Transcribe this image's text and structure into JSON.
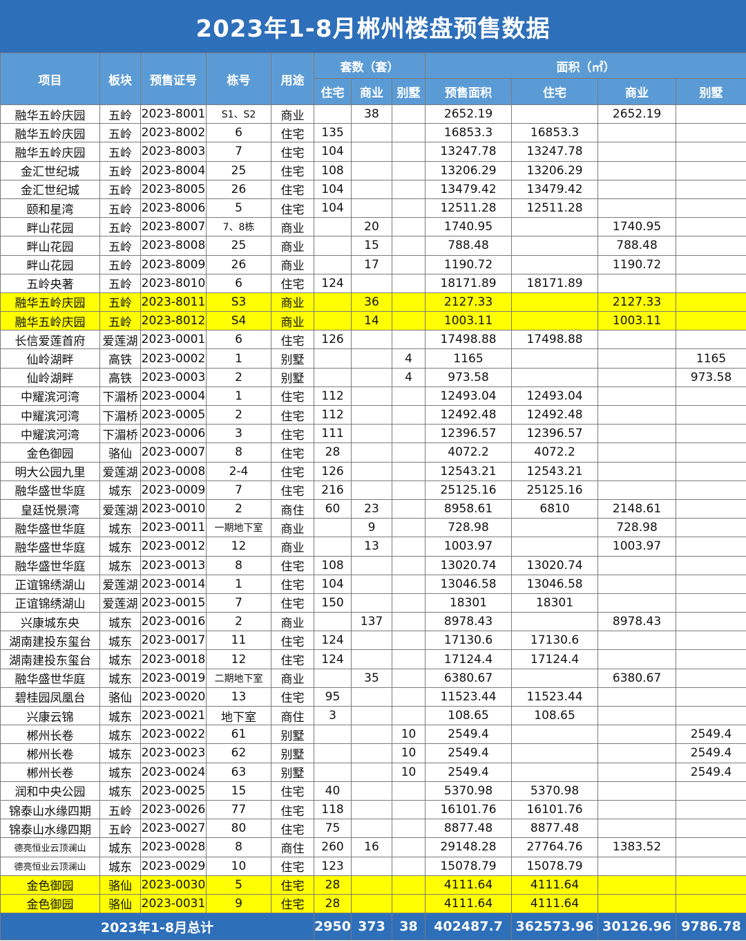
{
  "title": "2023年1-8月郴州楼盘预售数据",
  "headers": {
    "project": "项目",
    "block": "板块",
    "cert": "预售证号",
    "building": "栋号",
    "use": "用途",
    "units_group": "套数（套）",
    "area_group": "面积（㎡）",
    "units_residential": "住宅",
    "units_commercial": "商业",
    "units_villa": "别墅",
    "area_presale": "预售面积",
    "area_residential": "住宅",
    "area_commercial": "商业",
    "area_villa": "别墅"
  },
  "rows": [
    {
      "project": "融华五岭庆园",
      "block": "五岭",
      "cert": "2023-8001",
      "building": "S1、S2",
      "use": "商业",
      "ur": "",
      "uc": "38",
      "uv": "",
      "area": "2652.19",
      "ar": "",
      "ac": "2652.19",
      "av": "",
      "hl": false
    },
    {
      "project": "融华五岭庆园",
      "block": "五岭",
      "cert": "2023-8002",
      "building": "6",
      "use": "住宅",
      "ur": "135",
      "uc": "",
      "uv": "",
      "area": "16853.3",
      "ar": "16853.3",
      "ac": "",
      "av": "",
      "hl": false
    },
    {
      "project": "融华五岭庆园",
      "block": "五岭",
      "cert": "2023-8003",
      "building": "7",
      "use": "住宅",
      "ur": "104",
      "uc": "",
      "uv": "",
      "area": "13247.78",
      "ar": "13247.78",
      "ac": "",
      "av": "",
      "hl": false
    },
    {
      "project": "金汇世纪城",
      "block": "五岭",
      "cert": "2023-8004",
      "building": "25",
      "use": "住宅",
      "ur": "108",
      "uc": "",
      "uv": "",
      "area": "13206.29",
      "ar": "13206.29",
      "ac": "",
      "av": "",
      "hl": false
    },
    {
      "project": "金汇世纪城",
      "block": "五岭",
      "cert": "2023-8005",
      "building": "26",
      "use": "住宅",
      "ur": "104",
      "uc": "",
      "uv": "",
      "area": "13479.42",
      "ar": "13479.42",
      "ac": "",
      "av": "",
      "hl": false
    },
    {
      "project": "颐和星湾",
      "block": "五岭",
      "cert": "2023-8006",
      "building": "5",
      "use": "住宅",
      "ur": "104",
      "uc": "",
      "uv": "",
      "area": "12511.28",
      "ar": "12511.28",
      "ac": "",
      "av": "",
      "hl": false
    },
    {
      "project": "畔山花园",
      "block": "五岭",
      "cert": "2023-8007",
      "building": "7、8栋",
      "use": "商业",
      "ur": "",
      "uc": "20",
      "uv": "",
      "area": "1740.95",
      "ar": "",
      "ac": "1740.95",
      "av": "",
      "hl": false
    },
    {
      "project": "畔山花园",
      "block": "五岭",
      "cert": "2023-8008",
      "building": "25",
      "use": "商业",
      "ur": "",
      "uc": "15",
      "uv": "",
      "area": "788.48",
      "ar": "",
      "ac": "788.48",
      "av": "",
      "hl": false
    },
    {
      "project": "畔山花园",
      "block": "五岭",
      "cert": "2023-8009",
      "building": "26",
      "use": "商业",
      "ur": "",
      "uc": "17",
      "uv": "",
      "area": "1190.72",
      "ar": "",
      "ac": "1190.72",
      "av": "",
      "hl": false
    },
    {
      "project": "五岭央著",
      "block": "五岭",
      "cert": "2023-8010",
      "building": "6",
      "use": "住宅",
      "ur": "124",
      "uc": "",
      "uv": "",
      "area": "18171.89",
      "ar": "18171.89",
      "ac": "",
      "av": "",
      "hl": false
    },
    {
      "project": "融华五岭庆园",
      "block": "五岭",
      "cert": "2023-8011",
      "building": "S3",
      "use": "商业",
      "ur": "",
      "uc": "36",
      "uv": "",
      "area": "2127.33",
      "ar": "",
      "ac": "2127.33",
      "av": "",
      "hl": true
    },
    {
      "project": "融华五岭庆园",
      "block": "五岭",
      "cert": "2023-8012",
      "building": "S4",
      "use": "商业",
      "ur": "",
      "uc": "14",
      "uv": "",
      "area": "1003.11",
      "ar": "",
      "ac": "1003.11",
      "av": "",
      "hl": true
    },
    {
      "project": "长信爱莲首府",
      "block": "爱莲湖",
      "cert": "2023-0001",
      "building": "6",
      "use": "住宅",
      "ur": "126",
      "uc": "",
      "uv": "",
      "area": "17498.88",
      "ar": "17498.88",
      "ac": "",
      "av": "",
      "hl": false
    },
    {
      "project": "仙岭湖畔",
      "block": "高铁",
      "cert": "2023-0002",
      "building": "1",
      "use": "别墅",
      "ur": "",
      "uc": "",
      "uv": "4",
      "area": "1165",
      "ar": "",
      "ac": "",
      "av": "1165",
      "hl": false
    },
    {
      "project": "仙岭湖畔",
      "block": "高铁",
      "cert": "2023-0003",
      "building": "2",
      "use": "别墅",
      "ur": "",
      "uc": "",
      "uv": "4",
      "area": "973.58",
      "ar": "",
      "ac": "",
      "av": "973.58",
      "hl": false
    },
    {
      "project": "中耀滨河湾",
      "block": "下湄桥",
      "cert": "2023-0004",
      "building": "1",
      "use": "住宅",
      "ur": "112",
      "uc": "",
      "uv": "",
      "area": "12493.04",
      "ar": "12493.04",
      "ac": "",
      "av": "",
      "hl": false
    },
    {
      "project": "中耀滨河湾",
      "block": "下湄桥",
      "cert": "2023-0005",
      "building": "2",
      "use": "住宅",
      "ur": "112",
      "uc": "",
      "uv": "",
      "area": "12492.48",
      "ar": "12492.48",
      "ac": "",
      "av": "",
      "hl": false
    },
    {
      "project": "中耀滨河湾",
      "block": "下湄桥",
      "cert": "2023-0006",
      "building": "3",
      "use": "住宅",
      "ur": "111",
      "uc": "",
      "uv": "",
      "area": "12396.57",
      "ar": "12396.57",
      "ac": "",
      "av": "",
      "hl": false
    },
    {
      "project": "金色御园",
      "block": "骆仙",
      "cert": "2023-0007",
      "building": "8",
      "use": "住宅",
      "ur": "28",
      "uc": "",
      "uv": "",
      "area": "4072.2",
      "ar": "4072.2",
      "ac": "",
      "av": "",
      "hl": false
    },
    {
      "project": "明大公园九里",
      "block": "爱莲湖",
      "cert": "2023-0008",
      "building": "2-4",
      "use": "住宅",
      "ur": "126",
      "uc": "",
      "uv": "",
      "area": "12543.21",
      "ar": "12543.21",
      "ac": "",
      "av": "",
      "hl": false
    },
    {
      "project": "融华盛世华庭",
      "block": "城东",
      "cert": "2023-0009",
      "building": "7",
      "use": "住宅",
      "ur": "216",
      "uc": "",
      "uv": "",
      "area": "25125.16",
      "ar": "25125.16",
      "ac": "",
      "av": "",
      "hl": false
    },
    {
      "project": "皇廷悦景湾",
      "block": "爱莲湖",
      "cert": "2023-0010",
      "building": "2",
      "use": "商住",
      "ur": "60",
      "uc": "23",
      "uv": "",
      "area": "8958.61",
      "ar": "6810",
      "ac": "2148.61",
      "av": "",
      "hl": false
    },
    {
      "project": "融华盛世华庭",
      "block": "城东",
      "cert": "2023-0011",
      "building": "一期地下室",
      "use": "商业",
      "ur": "",
      "uc": "9",
      "uv": "",
      "area": "728.98",
      "ar": "",
      "ac": "728.98",
      "av": "",
      "hl": false
    },
    {
      "project": "融华盛世华庭",
      "block": "城东",
      "cert": "2023-0012",
      "building": "12",
      "use": "商业",
      "ur": "",
      "uc": "13",
      "uv": "",
      "area": "1003.97",
      "ar": "",
      "ac": "1003.97",
      "av": "",
      "hl": false
    },
    {
      "project": "融华盛世华庭",
      "block": "城东",
      "cert": "2023-0013",
      "building": "8",
      "use": "住宅",
      "ur": "108",
      "uc": "",
      "uv": "",
      "area": "13020.74",
      "ar": "13020.74",
      "ac": "",
      "av": "",
      "hl": false
    },
    {
      "project": "正谊锦绣湖山",
      "block": "爱莲湖",
      "cert": "2023-0014",
      "building": "1",
      "use": "住宅",
      "ur": "104",
      "uc": "",
      "uv": "",
      "area": "13046.58",
      "ar": "13046.58",
      "ac": "",
      "av": "",
      "hl": false
    },
    {
      "project": "正谊锦绣湖山",
      "block": "爱莲湖",
      "cert": "2023-0015",
      "building": "7",
      "use": "住宅",
      "ur": "150",
      "uc": "",
      "uv": "",
      "area": "18301",
      "ar": "18301",
      "ac": "",
      "av": "",
      "hl": false
    },
    {
      "project": "兴康城东央",
      "block": "城东",
      "cert": "2023-0016",
      "building": "2",
      "use": "商业",
      "ur": "",
      "uc": "137",
      "uv": "",
      "area": "8978.43",
      "ar": "",
      "ac": "8978.43",
      "av": "",
      "hl": false
    },
    {
      "project": "湖南建投东玺台",
      "block": "城东",
      "cert": "2023-0017",
      "building": "11",
      "use": "住宅",
      "ur": "124",
      "uc": "",
      "uv": "",
      "area": "17130.6",
      "ar": "17130.6",
      "ac": "",
      "av": "",
      "hl": false
    },
    {
      "project": "湖南建投东玺台",
      "block": "城东",
      "cert": "2023-0018",
      "building": "12",
      "use": "住宅",
      "ur": "124",
      "uc": "",
      "uv": "",
      "area": "17124.4",
      "ar": "17124.4",
      "ac": "",
      "av": "",
      "hl": false
    },
    {
      "project": "融华盛世华庭",
      "block": "城东",
      "cert": "2023-0019",
      "building": "二期地下室",
      "use": "商业",
      "ur": "",
      "uc": "35",
      "uv": "",
      "area": "6380.67",
      "ar": "",
      "ac": "6380.67",
      "av": "",
      "hl": false
    },
    {
      "project": "碧桂园凤凰台",
      "block": "骆仙",
      "cert": "2023-0020",
      "building": "13",
      "use": "住宅",
      "ur": "95",
      "uc": "",
      "uv": "",
      "area": "11523.44",
      "ar": "11523.44",
      "ac": "",
      "av": "",
      "hl": false
    },
    {
      "project": "兴康云锦",
      "block": "城东",
      "cert": "2023-0021",
      "building": "地下室",
      "use": "商住",
      "ur": "3",
      "uc": "",
      "uv": "",
      "area": "108.65",
      "ar": "108.65",
      "ac": "",
      "av": "",
      "hl": false
    },
    {
      "project": "郴州长卷",
      "block": "城东",
      "cert": "2023-0022",
      "building": "61",
      "use": "别墅",
      "ur": "",
      "uc": "",
      "uv": "10",
      "area": "2549.4",
      "ar": "",
      "ac": "",
      "av": "2549.4",
      "hl": false
    },
    {
      "project": "郴州长卷",
      "block": "城东",
      "cert": "2023-0023",
      "building": "62",
      "use": "别墅",
      "ur": "",
      "uc": "",
      "uv": "10",
      "area": "2549.4",
      "ar": "",
      "ac": "",
      "av": "2549.4",
      "hl": false
    },
    {
      "project": "郴州长卷",
      "block": "城东",
      "cert": "2023-0024",
      "building": "63",
      "use": "别墅",
      "ur": "",
      "uc": "",
      "uv": "10",
      "area": "2549.4",
      "ar": "",
      "ac": "",
      "av": "2549.4",
      "hl": false
    },
    {
      "project": "润和中央公园",
      "block": "城东",
      "cert": "2023-0025",
      "building": "15",
      "use": "住宅",
      "ur": "40",
      "uc": "",
      "uv": "",
      "area": "5370.98",
      "ar": "5370.98",
      "ac": "",
      "av": "",
      "hl": false
    },
    {
      "project": "锦泰山水缘四期",
      "block": "五岭",
      "cert": "2023-0026",
      "building": "77",
      "use": "住宅",
      "ur": "118",
      "uc": "",
      "uv": "",
      "area": "16101.76",
      "ar": "16101.76",
      "ac": "",
      "av": "",
      "hl": false
    },
    {
      "project": "锦泰山水缘四期",
      "block": "五岭",
      "cert": "2023-0027",
      "building": "80",
      "use": "住宅",
      "ur": "75",
      "uc": "",
      "uv": "",
      "area": "8877.48",
      "ar": "8877.48",
      "ac": "",
      "av": "",
      "hl": false
    },
    {
      "project": "德亮恒业云顶澜山",
      "block": "城东",
      "cert": "2023-0028",
      "building": "8",
      "use": "商住",
      "ur": "260",
      "uc": "16",
      "uv": "",
      "area": "29148.28",
      "ar": "27764.76",
      "ac": "1383.52",
      "av": "",
      "hl": false
    },
    {
      "project": "德亮恒业云顶澜山",
      "block": "城东",
      "cert": "2023-0029",
      "building": "10",
      "use": "住宅",
      "ur": "123",
      "uc": "",
      "uv": "",
      "area": "15078.79",
      "ar": "15078.79",
      "ac": "",
      "av": "",
      "hl": false
    },
    {
      "project": "金色御园",
      "block": "骆仙",
      "cert": "2023-0030",
      "building": "5",
      "use": "住宅",
      "ur": "28",
      "uc": "",
      "uv": "",
      "area": "4111.64",
      "ar": "4111.64",
      "ac": "",
      "av": "",
      "hl": true
    },
    {
      "project": "金色御园",
      "block": "骆仙",
      "cert": "2023-0031",
      "building": "9",
      "use": "住宅",
      "ur": "28",
      "uc": "",
      "uv": "",
      "area": "4111.64",
      "ar": "4111.64",
      "ac": "",
      "av": "",
      "hl": true
    }
  ],
  "total": {
    "label": "2023年1-8月总计",
    "ur": "2950",
    "uc": "373",
    "uv": "38",
    "area": "402487.7",
    "ar": "362573.96",
    "ac": "30126.96",
    "av": "9786.78"
  },
  "colors": {
    "title_bg": "#2e6fba",
    "header_bg": "#5b9bd5",
    "highlight": "#ffff00",
    "footer_bg": "#2e6fba"
  }
}
